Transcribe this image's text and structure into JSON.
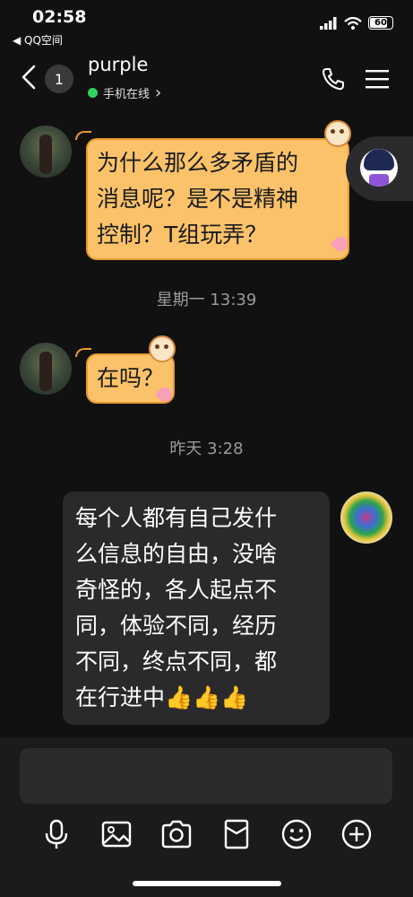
{
  "status_bar": {
    "time": "02:58",
    "back_app": "◀ QQ空间",
    "battery": "60"
  },
  "header": {
    "unread_count": "1",
    "contact_name": "purple",
    "online_status": "手机在线",
    "online_arrow": "›"
  },
  "messages": [
    {
      "from": "them",
      "text_lines": [
        "为什么那么多矛盾的",
        "消息呢？是不是精神",
        "控制？T组玩弄？"
      ]
    },
    {
      "timestamp": "星期一 13:39"
    },
    {
      "from": "them",
      "text_lines": [
        "在吗？"
      ]
    },
    {
      "timestamp": "昨天 3:28"
    },
    {
      "from": "me",
      "text_lines": [
        "每个人都有自己发什",
        "么信息的自由，没啥",
        "奇怪的，各人起点不",
        "同，体验不同，经历",
        "不同，终点不同，都",
        "在行进中👍👍👍"
      ]
    }
  ],
  "toolbar": [
    "microphone-icon",
    "image-icon",
    "camera-icon",
    "red-packet-icon",
    "emoji-icon",
    "plus-icon"
  ],
  "colors": {
    "background": "#111111",
    "their_bubble": "#fbc26a",
    "their_bubble_border": "#e89a2e",
    "my_bubble": "#2a2a2c",
    "online_dot": "#2fd35b"
  }
}
